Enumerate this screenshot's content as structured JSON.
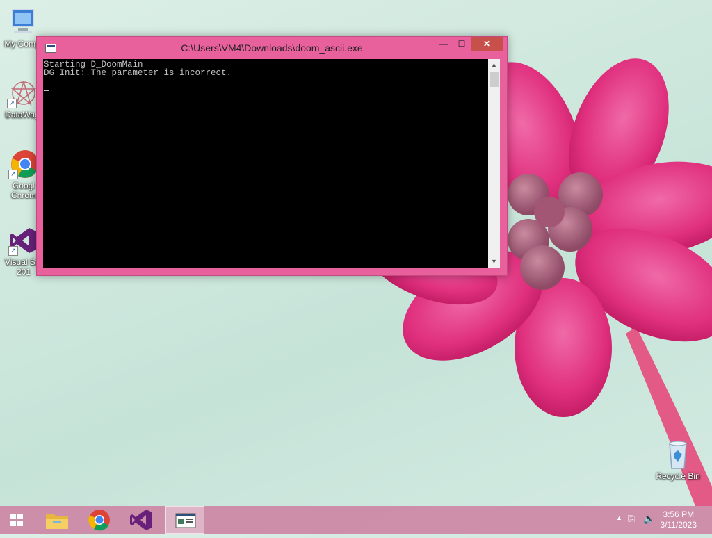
{
  "desktop": {
    "icons": [
      {
        "label": "My Comp",
        "icon": "computer-icon"
      },
      {
        "label": "DataWag",
        "icon": "datawagon-icon"
      },
      {
        "label": "Googl\nChrom",
        "icon": "chrome-icon"
      },
      {
        "label": "Visual Stu\n201",
        "icon": "visual-studio-icon"
      },
      {
        "label": "Recycle Bin",
        "icon": "recycle-bin-icon"
      }
    ]
  },
  "window": {
    "title": "C:\\Users\\VM4\\Downloads\\doom_ascii.exe",
    "minimize_label": "—",
    "maximize_label": "☐",
    "close_label": "✕",
    "console_lines": [
      "Starting D_DoomMain",
      "DG_Init: The parameter is incorrect."
    ]
  },
  "taskbar": {
    "items": [
      {
        "name": "file-explorer",
        "icon": "folder-icon"
      },
      {
        "name": "chrome",
        "icon": "chrome-icon"
      },
      {
        "name": "visual-studio",
        "icon": "visual-studio-icon"
      },
      {
        "name": "console",
        "icon": "console-icon"
      }
    ],
    "clock_time": "3:56 PM",
    "clock_date": "3/11/2023"
  }
}
